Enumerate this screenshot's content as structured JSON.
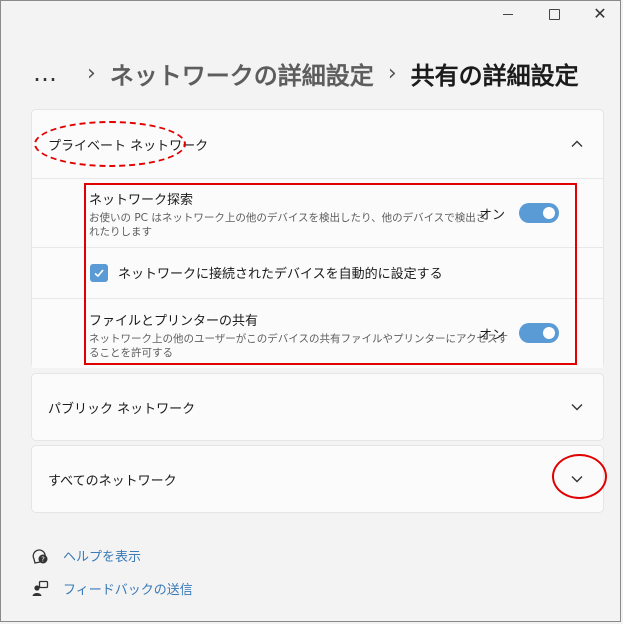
{
  "window": {
    "minimize_icon": "minimize-icon",
    "maximize_icon": "maximize-icon",
    "close_icon": "close-icon"
  },
  "breadcrumb": {
    "more": "…",
    "parent": "ネットワークの詳細設定",
    "current": "共有の詳細設定"
  },
  "private_network": {
    "title": "プライベート ネットワーク",
    "expanded": true,
    "discovery": {
      "title": "ネットワーク探索",
      "desc_line1": "お使いの PC はネットワーク上の他のデバイスを検出したり、他のデバイスで検出さ",
      "desc_line2": "れたりします",
      "state": "オン",
      "on": true
    },
    "auto_setup": {
      "label": "ネットワークに接続されたデバイスを自動的に設定する",
      "checked": true
    },
    "file_sharing": {
      "title": "ファイルとプリンターの共有",
      "desc_line1": "ネットワーク上の他のユーザーがこのデバイスの共有ファイルやプリンターにアクセスす",
      "desc_line2": "ることを許可する",
      "state": "オン",
      "on": true
    }
  },
  "public_network": {
    "title": "パブリック ネットワーク",
    "expanded": false
  },
  "all_networks": {
    "title": "すべてのネットワーク",
    "expanded": false
  },
  "footer": {
    "help": "ヘルプを表示",
    "feedback": "フィードバックの送信"
  },
  "colors": {
    "accent": "#5b9bd5",
    "annotation": "#e00000",
    "link": "#3a7ab8"
  }
}
